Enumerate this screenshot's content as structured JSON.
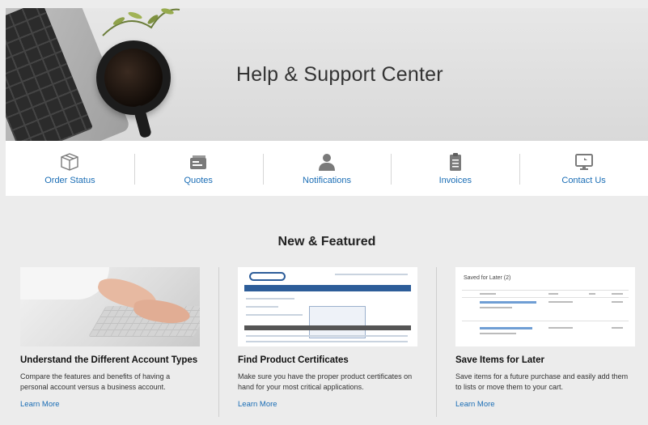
{
  "hero": {
    "title": "Help & Support Center"
  },
  "nav": {
    "items": [
      {
        "label": "Order Status",
        "icon": "box-icon"
      },
      {
        "label": "Quotes",
        "icon": "quote-card-icon"
      },
      {
        "label": "Notifications",
        "icon": "person-icon"
      },
      {
        "label": "Invoices",
        "icon": "clipboard-icon"
      },
      {
        "label": "Contact Us",
        "icon": "monitor-icon"
      }
    ]
  },
  "featured": {
    "title": "New & Featured",
    "cards": [
      {
        "title": "Understand the Different Account Types",
        "description": "Compare the features and benefits of having a personal account versus a business account.",
        "link": "Learn More"
      },
      {
        "title": "Find Product Certificates",
        "description": "Make sure you have the proper product certificates on hand for your most critical applications.",
        "link": "Learn More"
      },
      {
        "title": "Save Items for Later",
        "description": "Save items for a future purchase and easily add them to lists or move them to your cart.",
        "link": "Learn More",
        "preview_title": "Saved for Later (2)"
      }
    ]
  },
  "colors": {
    "link": "#1a6db5",
    "icon": "#777777",
    "background": "#ececec"
  }
}
